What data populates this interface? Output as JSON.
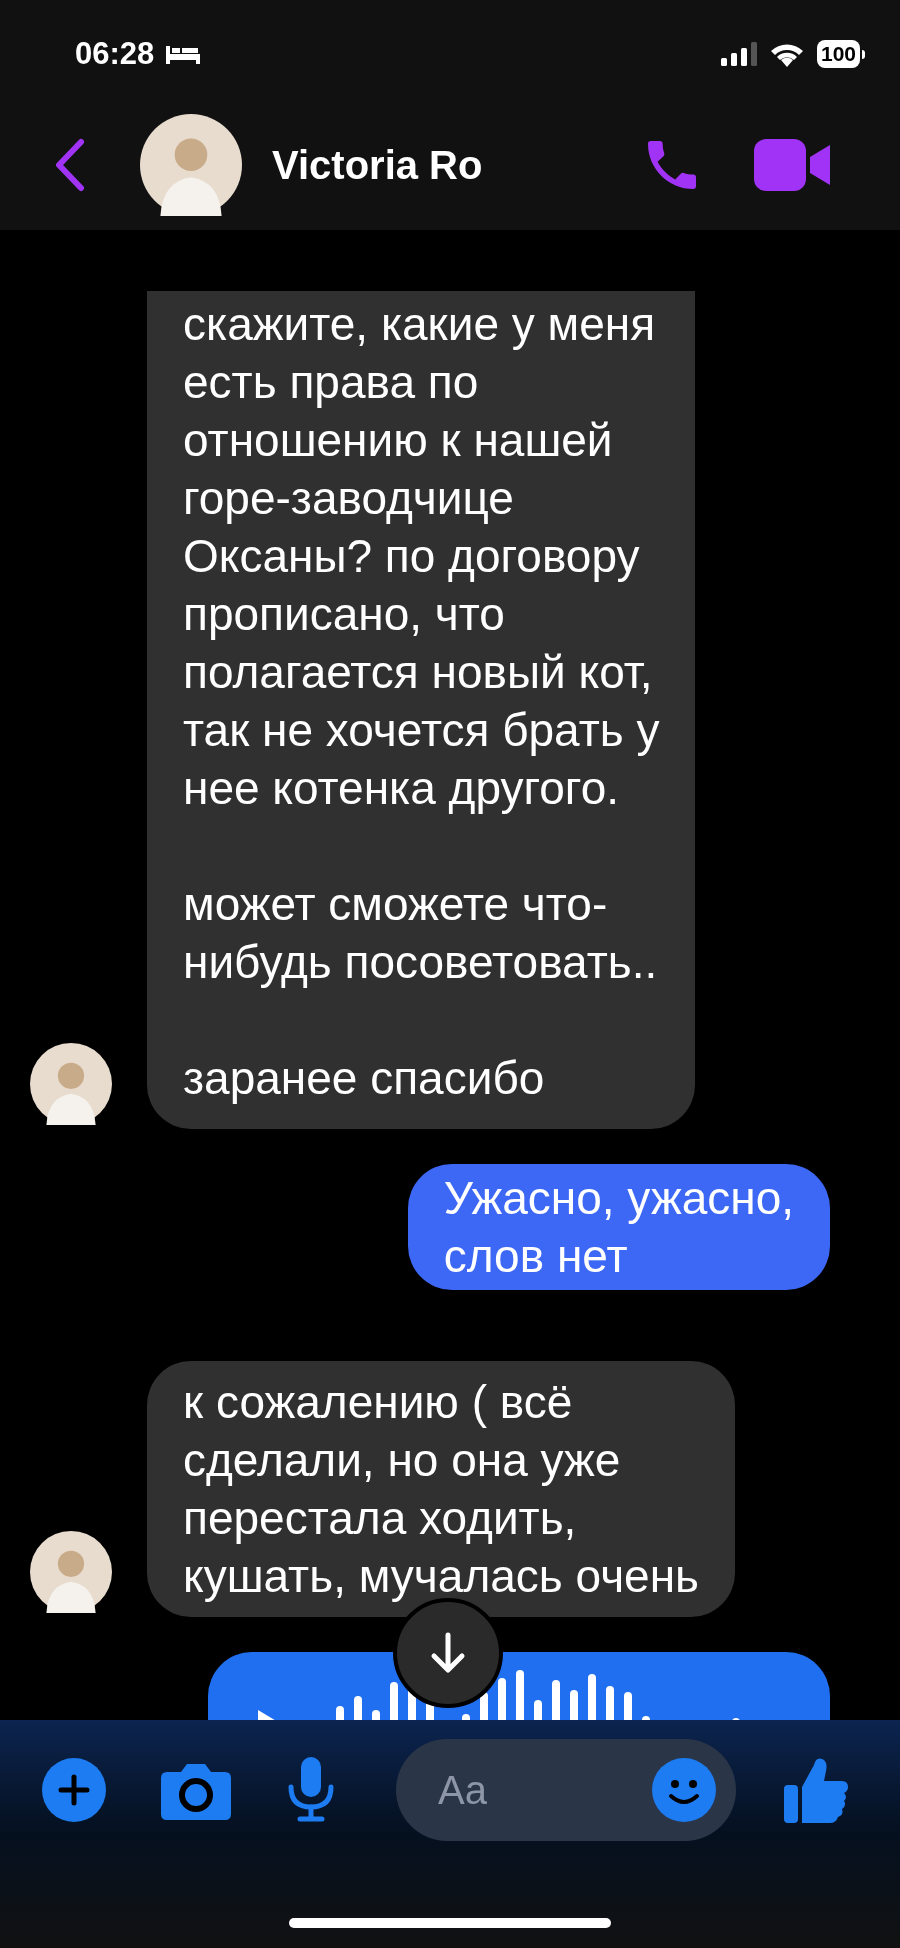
{
  "status_bar": {
    "time": "06:28",
    "battery": "100"
  },
  "header": {
    "contact_name": "Victoria Ro"
  },
  "messages": [
    {
      "outgoing": false,
      "kind": "text",
      "text": "скажите, какие у меня\nесть права по\nотношению к нашей\nгоре-заводчице\nОксаны? по договору\nпрописано, что\nполагается новый кот,\nтак не хочется брать у\nнее котенка другого.\n\nможет сможете что-\nнибудь посоветовать..\n\nзаранее спасибо"
    },
    {
      "outgoing": true,
      "kind": "text",
      "text": "Ужасно, ужасно,\nслов нет"
    },
    {
      "outgoing": false,
      "kind": "text",
      "text": "к сожалению ( всё\nсделали, но она уже\nперестала ходить,\nкушать, мучалась очень"
    },
    {
      "outgoing": true,
      "kind": "voice"
    }
  ],
  "composer": {
    "placeholder": "Aa"
  }
}
